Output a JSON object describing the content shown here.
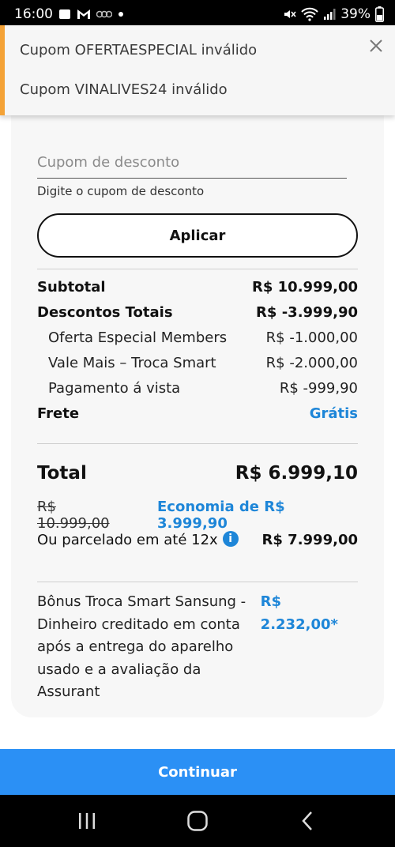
{
  "status_bar": {
    "time": "16:00",
    "battery": "39%",
    "icons": [
      "image-icon",
      "gmail-icon",
      "app-icon",
      "dot-icon",
      "mute-icon",
      "wifi-icon",
      "signal-icon",
      "battery-icon"
    ]
  },
  "toast": {
    "messages": [
      "Cupom OFERTAESPECIAL inválido",
      "Cupom VINALIVES24 inválido"
    ],
    "accent_color": "#f4a236",
    "close_icon": "close-icon"
  },
  "coupon": {
    "placeholder": "Cupom de desconto",
    "value": "",
    "helper": "Digite o cupom de desconto",
    "apply_label": "Aplicar"
  },
  "summary": {
    "subtotal_label": "Subtotal",
    "subtotal_value": "R$ 10.999,00",
    "discounts_label": "Descontos Totais",
    "discounts_value": "R$ -3.999,90",
    "discount_items": [
      {
        "label": "Oferta Especial Members",
        "value": "R$ -1.000,00"
      },
      {
        "label": "Vale Mais – Troca Smart",
        "value": "R$ -2.000,00"
      },
      {
        "label": "Pagamento á vista",
        "value": "R$ -999,90"
      }
    ],
    "shipping_label": "Frete",
    "shipping_value": "Grátis"
  },
  "total": {
    "label": "Total",
    "value": "R$ 6.999,10",
    "original_price": "R$ 10.999,00",
    "economy": "Economia de R$ 3.999,90",
    "installment_label": "Ou parcelado em até 12x",
    "installment_value": "R$ 7.999,00",
    "info_icon": "i"
  },
  "bonus": {
    "text": "Bônus Troca Smart Sansung - Dinheiro creditado em conta após a entrega do aparelho usado e a avaliação da Assurant",
    "value": "R$ 2.232,00*"
  },
  "continue_label": "Continuar",
  "colors": {
    "accent_blue": "#1e86d8",
    "button_blue": "#2b90f5",
    "card_bg": "#f7f7f7"
  },
  "nav": [
    "recent-apps-icon",
    "home-icon",
    "back-icon"
  ]
}
